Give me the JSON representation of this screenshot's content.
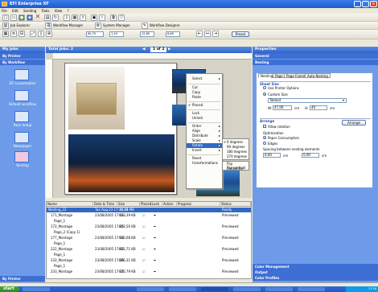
{
  "window": {
    "title": "EFI Enterprise XF",
    "min": "_",
    "max": "□",
    "close": "×"
  },
  "menu": [
    "File",
    "Edit",
    "Sending",
    "Tools",
    "View",
    "?"
  ],
  "toolbar2": {
    "job_explorer": "Job Explorer",
    "workflow_manager": "Workflow Manager",
    "system_manager": "System Manager",
    "workflow_designer": "Workflow Designer"
  },
  "toolbar3": {
    "zoom": "90,70",
    "w": "1,29",
    "x": "12,85",
    "y": "6,89",
    "preset_btn": "Preset"
  },
  "panes": {
    "my_jobs": "My Jobs",
    "total_jobs": "Total Jobs: 2",
    "page_nav": "1 of 2",
    "properties": "Properties"
  },
  "left": {
    "sec_printer": "By Printer",
    "sec_workflow": "By Workflow",
    "workflows": [
      "EFI Linearization",
      "Default workflow",
      "Paris Setup",
      "Newspaper",
      "Nesting"
    ],
    "sec_bottom": "By Printer"
  },
  "context_menu": {
    "items": [
      "Select",
      "Cut",
      "Copy",
      "Paste",
      "Placed",
      "Lock",
      "Unlock",
      "Order",
      "Align",
      "Distribute",
      "Scale",
      "Rotate",
      "Invert",
      "Reset transformations"
    ],
    "rotate_sub": [
      "0 degrees",
      "90 degrees",
      "180 degrees",
      "270 degrees"
    ],
    "flip_sub": [
      "Flip horizontal",
      "Flip vertical"
    ]
  },
  "jobs": {
    "headers": [
      "Name",
      "Date & Time",
      "Size",
      "Placed",
      "Lock",
      "Action",
      "Progress",
      "Status"
    ],
    "rows": [
      {
        "name": "Nesting_22",
        "date": "Tue Aug 23 17:17:48",
        "size": "36,31 MB",
        "status": "Ready"
      },
      {
        "name": "171_Montage",
        "date": "23/08/2005 17:15",
        "size": "943,39 KB",
        "status": "Previewed"
      },
      {
        "name": "Page_1",
        "date": "",
        "size": "",
        "status": ""
      },
      {
        "name": "172_Montage",
        "date": "23/08/2005 17:15",
        "size": "803,56 KB",
        "status": "Previewed"
      },
      {
        "name": "Page_2 (Copy 1)",
        "date": "",
        "size": "",
        "status": ""
      },
      {
        "name": "177_Montage",
        "date": "23/08/2005 17:15",
        "size": "940,08 KB",
        "status": "Previewed"
      },
      {
        "name": "Page_1",
        "date": "",
        "size": "",
        "status": ""
      },
      {
        "name": "222_Montage",
        "date": "23/08/2005 17:15",
        "size": "801,71 KB",
        "status": "Previewed"
      },
      {
        "name": "Page_1",
        "date": "",
        "size": "",
        "status": ""
      },
      {
        "name": "232_Montage",
        "date": "23/08/2005 17:15",
        "size": "896,31 KB",
        "status": "Previewed"
      },
      {
        "name": "Page_1",
        "date": "",
        "size": "",
        "status": ""
      },
      {
        "name": "233_Montage",
        "date": "23/08/2005 17:15",
        "size": "935,79 KB",
        "status": "Previewed"
      }
    ]
  },
  "right": {
    "sec_general": "General",
    "sec_nesting": "Nesting",
    "tabs": [
      "Nesting",
      "Page",
      "Page Frame",
      "Auto Nesting"
    ],
    "sheet_size": "Sheet Size",
    "use_printer": "Use Printer Options",
    "custom_size": "Custom Size",
    "custom_select": "Tabloid",
    "w_label": "W:",
    "w_val": "47,00",
    "w_unit": "cm",
    "h_label": "H:",
    "h_val": "40",
    "h_unit": "cm",
    "arrange": "Arrange",
    "arrange_btn": "Arrange",
    "allow_rotation": "Allow rotation",
    "optimization": "Optimization",
    "paper_consumption": "Paper Consumption",
    "edges": "Edges",
    "spacing": "Spacing between nesting elements",
    "x_val": "0,00",
    "y_val": "0,00",
    "unit": "cm",
    "sec_color": "Color Management",
    "sec_output": "Output",
    "sec_profiles": "Color Profiles"
  },
  "taskbar": {
    "start": "start",
    "clock": "17:18"
  }
}
